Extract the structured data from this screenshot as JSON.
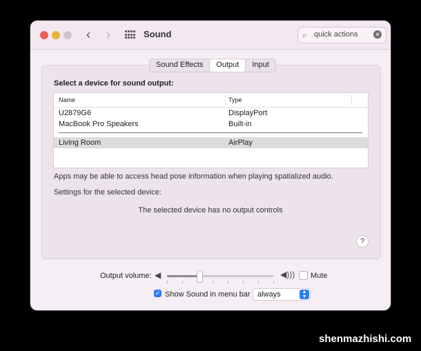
{
  "window": {
    "title": "Sound"
  },
  "search": {
    "value": "quick actions"
  },
  "tabs": [
    {
      "label": "Sound Effects",
      "active": false
    },
    {
      "label": "Output",
      "active": true
    },
    {
      "label": "Input",
      "active": false
    }
  ],
  "output": {
    "prompt": "Select a device for sound output:",
    "columns": [
      "Name",
      "Type"
    ],
    "devices": [
      {
        "name": "U2879G6",
        "type": "DisplayPort",
        "selected": false
      },
      {
        "name": "MacBook Pro Speakers",
        "type": "Built-in",
        "selected": false
      },
      {
        "name": "Living Room",
        "type": "AirPlay",
        "selected": true
      }
    ],
    "info_text": "Apps may be able to access head pose information when playing spatialized audio.",
    "settings_label": "Settings for the selected device:",
    "no_controls_text": "The selected device has no output controls",
    "help_label": "?"
  },
  "volume": {
    "label": "Output volume:",
    "level_fraction": 0.3,
    "mute_label": "Mute",
    "muted": false
  },
  "menu_bar": {
    "label": "Show Sound in menu bar",
    "checked": true,
    "select_value": "always"
  },
  "watermark": "shenmazhishi.com",
  "colors": {
    "accent": "#2f7cf6",
    "close": "#ec5f57",
    "minimize": "#e9b13c"
  }
}
